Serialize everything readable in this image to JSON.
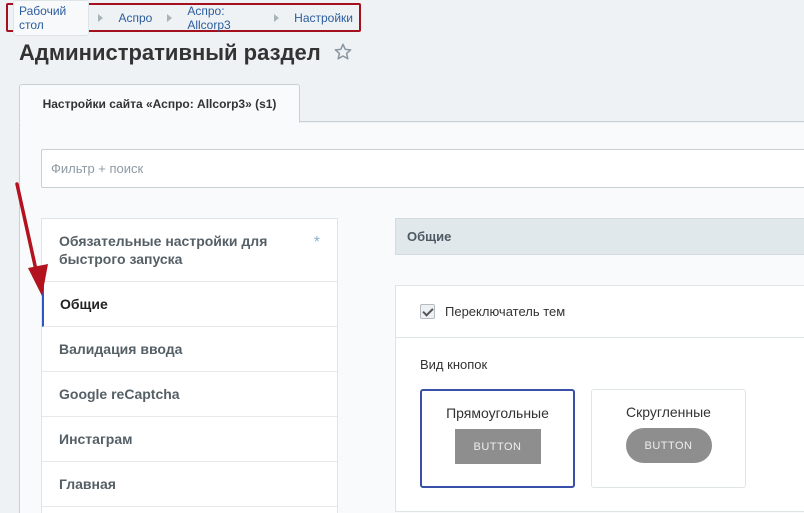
{
  "breadcrumb": [
    "Рабочий стол",
    "Аспро",
    "Аспро: Allcorp3",
    "Настройки"
  ],
  "page_title": "Административный раздел",
  "tab": {
    "label": "Настройки сайта «Аспро: Allcorp3» (s1)"
  },
  "filter": {
    "placeholder": "Фильтр + поиск"
  },
  "menu": {
    "items": [
      {
        "label": "Обязательные настройки для быстрого запуска",
        "marker": "*"
      },
      {
        "label": "Общие"
      },
      {
        "label": "Валидация ввода"
      },
      {
        "label": "Google reCaptcha"
      },
      {
        "label": "Инстаграм"
      },
      {
        "label": "Главная"
      }
    ],
    "active_index": 1
  },
  "section": {
    "header": "Общие",
    "toggle_label": "Переключатель тем",
    "toggle_checked": true,
    "buttons_label": "Вид кнопок",
    "button_styles": [
      {
        "title": "Прямоугольные",
        "sample": "BUTTON",
        "selected": true
      },
      {
        "title": "Скругленные",
        "sample": "BUTTON",
        "selected": false
      }
    ]
  },
  "colors": {
    "highlight_frame": "#a4101d",
    "active_accent": "#2f56c4",
    "arrow": "#b3121f"
  }
}
